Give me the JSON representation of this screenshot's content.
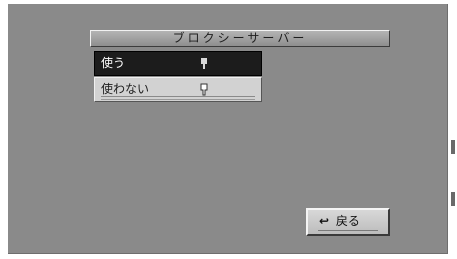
{
  "panel": {
    "title": "ブロクシーサーバー"
  },
  "options": [
    {
      "label": "使う",
      "selected": true
    },
    {
      "label": "使わない",
      "selected": false
    }
  ],
  "back_button": {
    "icon": "return-arrow-icon",
    "label": "戻る"
  },
  "colors": {
    "screen_background": "#8a8a8a",
    "selected_row": "#1c1c1c",
    "unselected_row": "#d2d2d2",
    "button_face": "#cacaca"
  }
}
